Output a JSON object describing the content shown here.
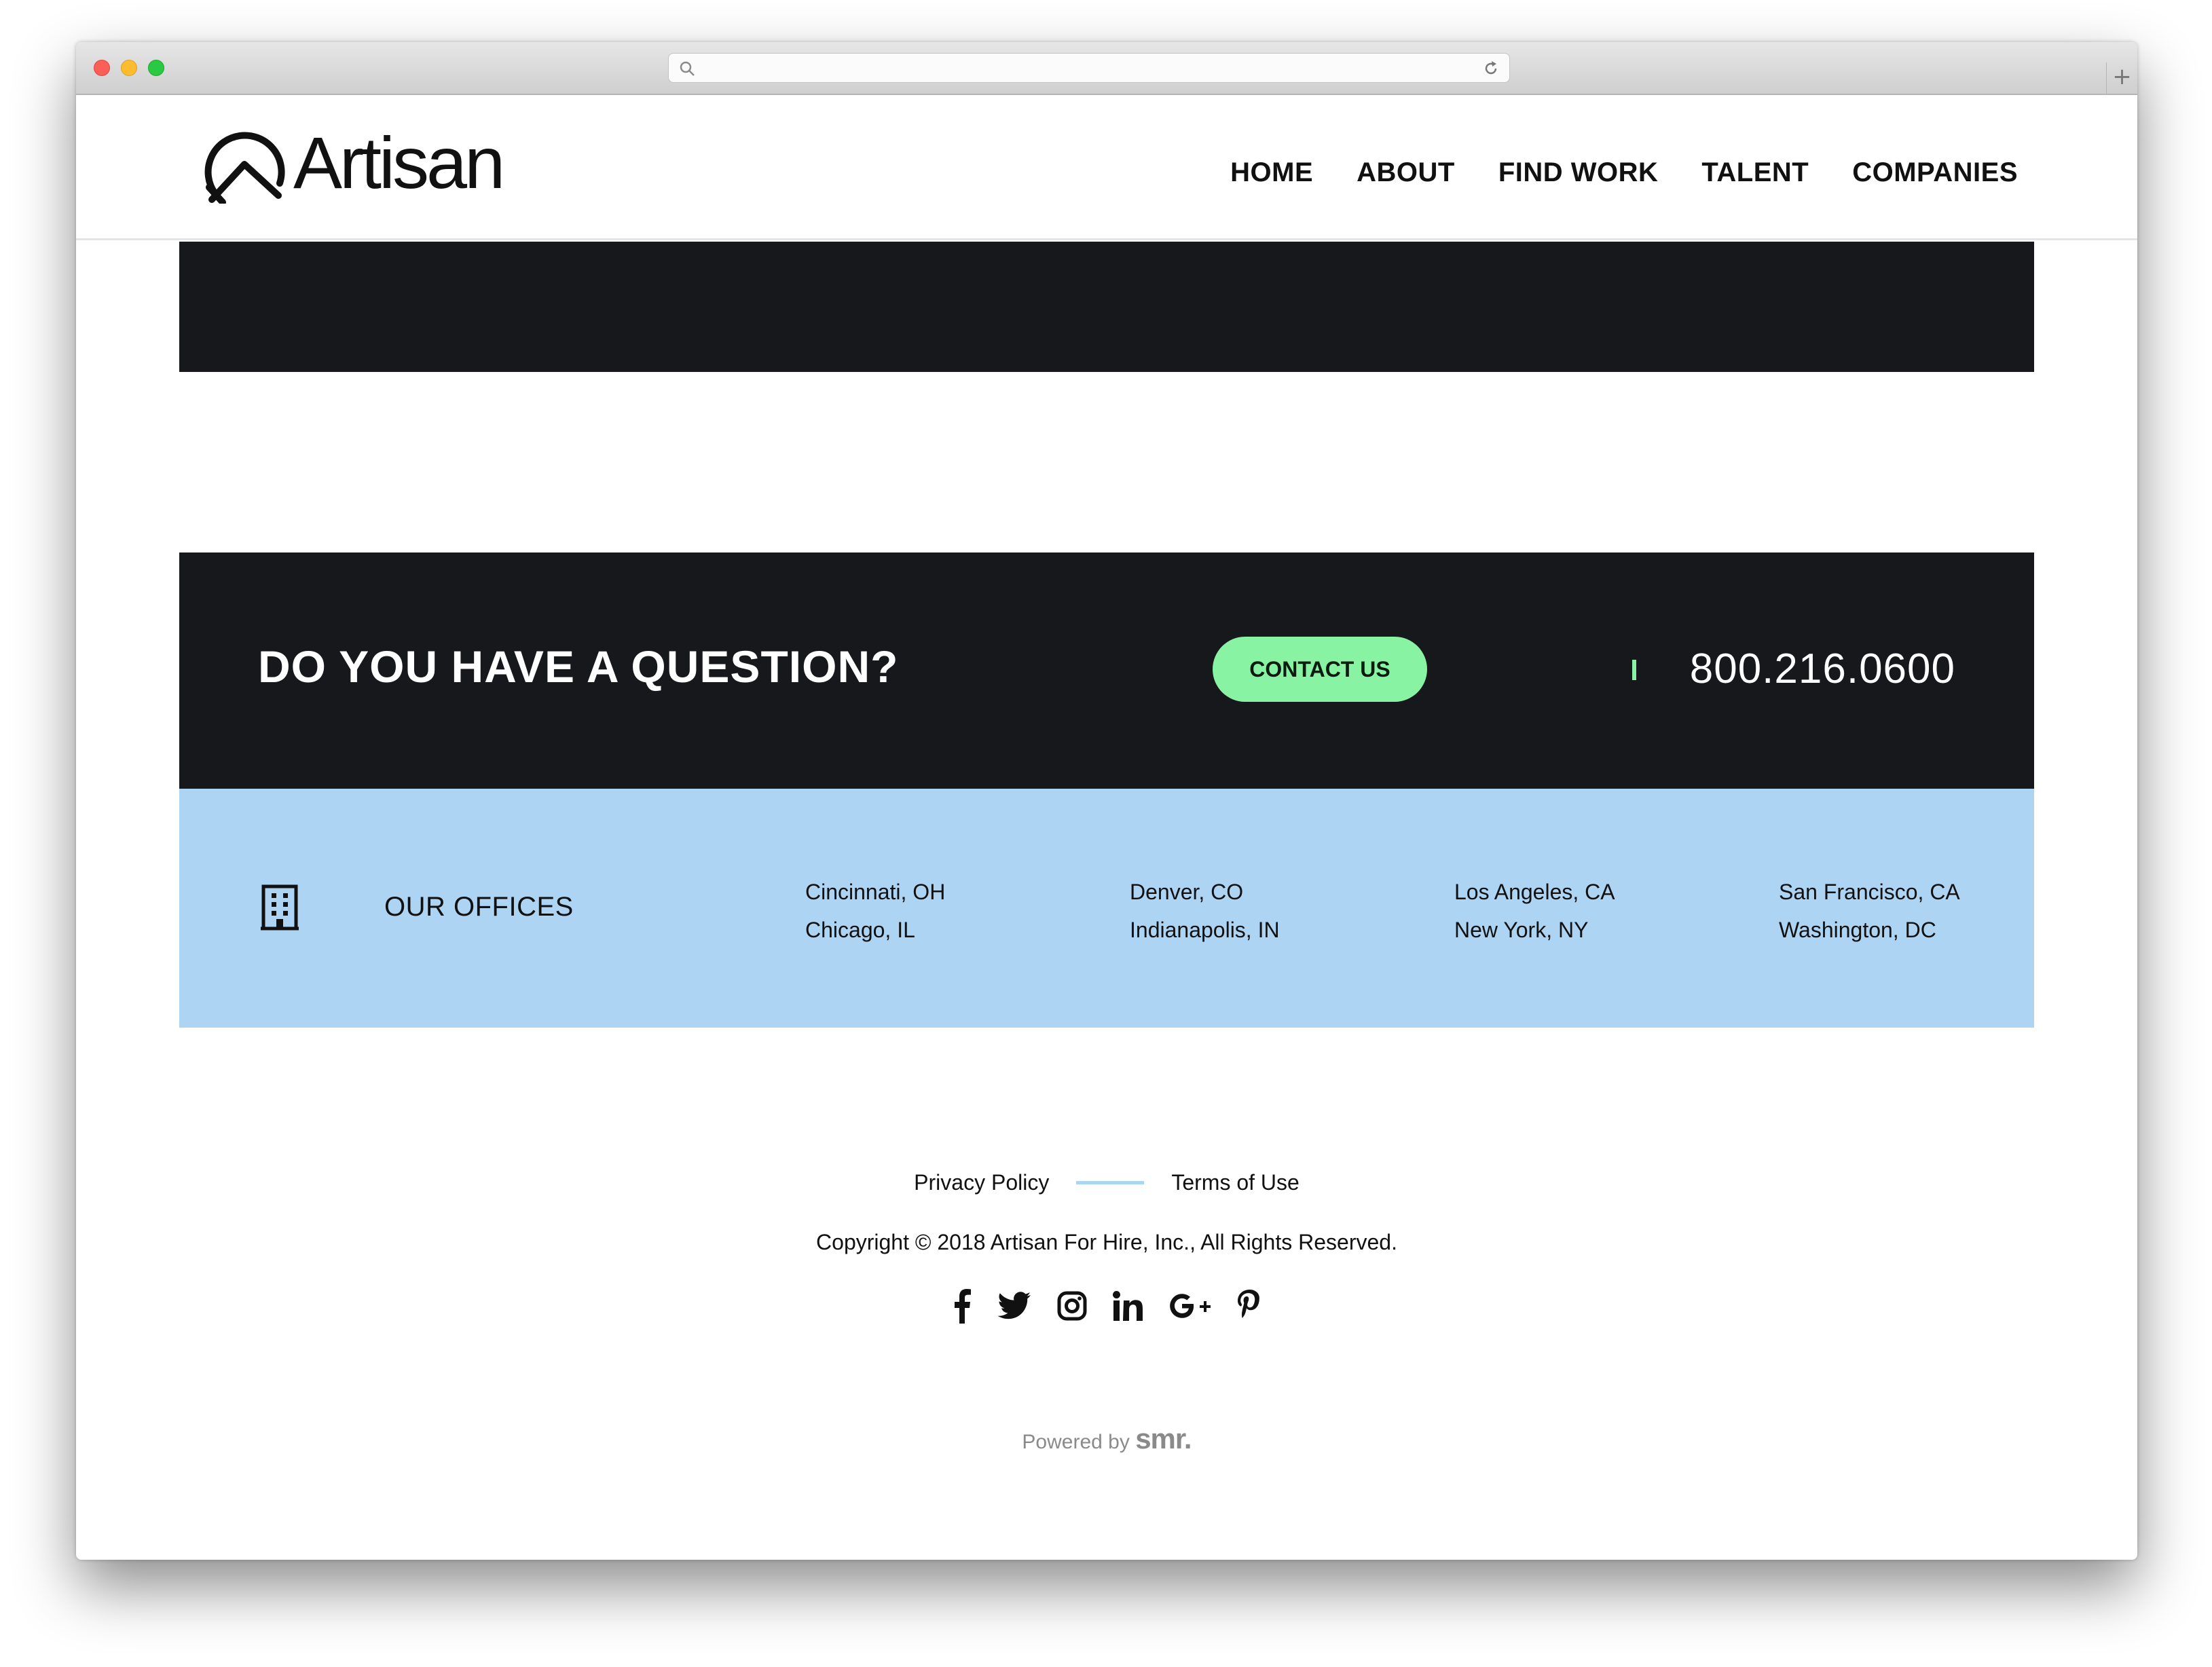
{
  "brand": {
    "name": "Artisan"
  },
  "nav": {
    "items": [
      "HOME",
      "ABOUT",
      "FIND WORK",
      "TALENT",
      "COMPANIES"
    ]
  },
  "question": {
    "title": "DO YOU HAVE A QUESTION?",
    "contact_label": "CONTACT US",
    "phone": "800.216.0600"
  },
  "offices": {
    "label": "OUR OFFICES",
    "columns": [
      [
        "Cincinnati, OH",
        "Chicago, IL"
      ],
      [
        "Denver, CO",
        "Indianapolis, IN"
      ],
      [
        "Los Angeles, CA",
        "New York, NY"
      ],
      [
        "San Francisco, CA",
        "Washington, DC"
      ]
    ]
  },
  "footer": {
    "privacy": "Privacy Policy",
    "terms": "Terms of Use",
    "copyright": "Copyright © 2018 Artisan For Hire, Inc., All Rights Reserved.",
    "social_icons": [
      "facebook-icon",
      "twitter-icon",
      "instagram-icon",
      "linkedin-icon",
      "google-plus-icon",
      "pinterest-icon"
    ],
    "powered_prefix": "Powered by",
    "powered_brand": "smr."
  },
  "colors": {
    "dark": "#17181c",
    "accent_green": "#88f4a3",
    "office_blue": "#aed4f4",
    "link_divider": "#a9d6f0"
  }
}
